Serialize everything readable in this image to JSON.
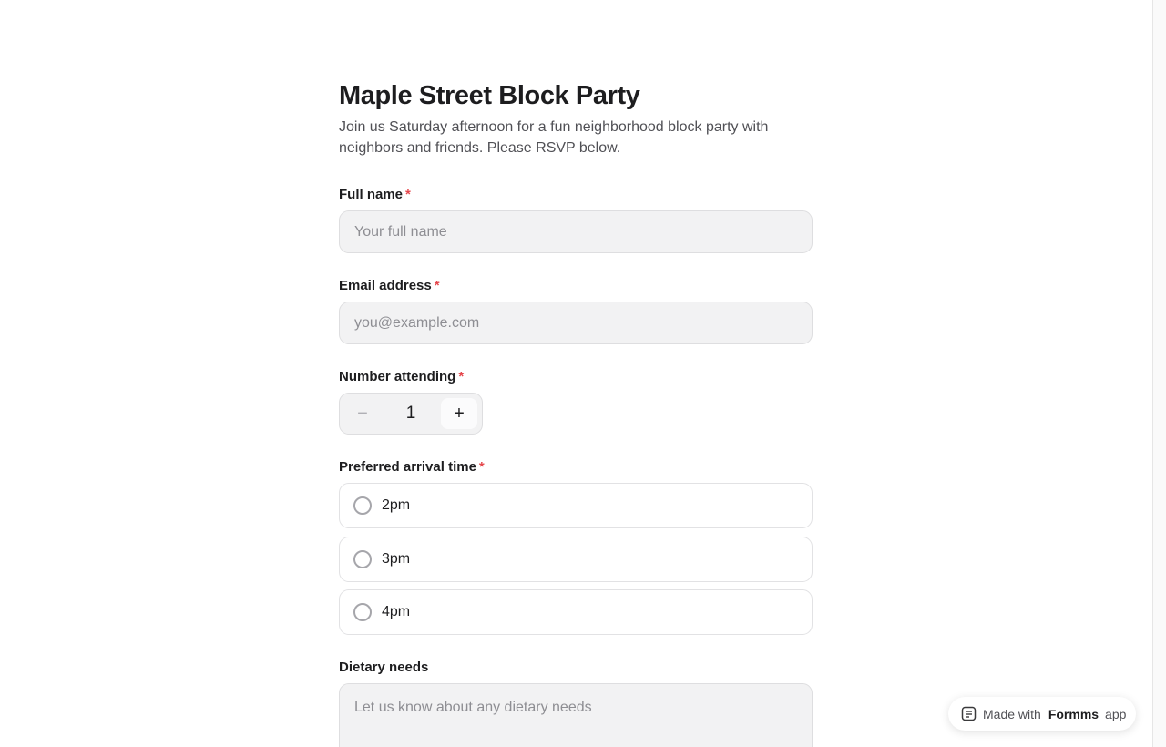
{
  "form": {
    "title": "Maple Street Block Party",
    "description": "Join us Saturday afternoon for a fun neighborhood block party with neighbors and friends. Please RSVP below."
  },
  "fields": {
    "full_name": {
      "label": "Full name",
      "required_mark": "*",
      "placeholder": "Your full name",
      "value": ""
    },
    "email": {
      "label": "Email address",
      "required_mark": "*",
      "placeholder": "you@example.com",
      "value": ""
    },
    "attending": {
      "label": "Number attending",
      "required_mark": "*",
      "value": "1",
      "decrement_symbol": "−",
      "increment_symbol": "+"
    },
    "arrival": {
      "label": "Preferred arrival time",
      "required_mark": "*",
      "options": [
        {
          "label": "2pm",
          "selected": false
        },
        {
          "label": "3pm",
          "selected": false
        },
        {
          "label": "4pm",
          "selected": false
        }
      ]
    },
    "dietary": {
      "label": "Dietary needs",
      "placeholder": "Let us know about any dietary needs",
      "value": ""
    }
  },
  "badge": {
    "prefix": "Made with",
    "brand": "Formms",
    "suffix": "app",
    "icon": "form-icon"
  },
  "colors": {
    "required": "#e5484d",
    "input_bg": "#f2f2f3",
    "text": "#1d1d1f"
  }
}
